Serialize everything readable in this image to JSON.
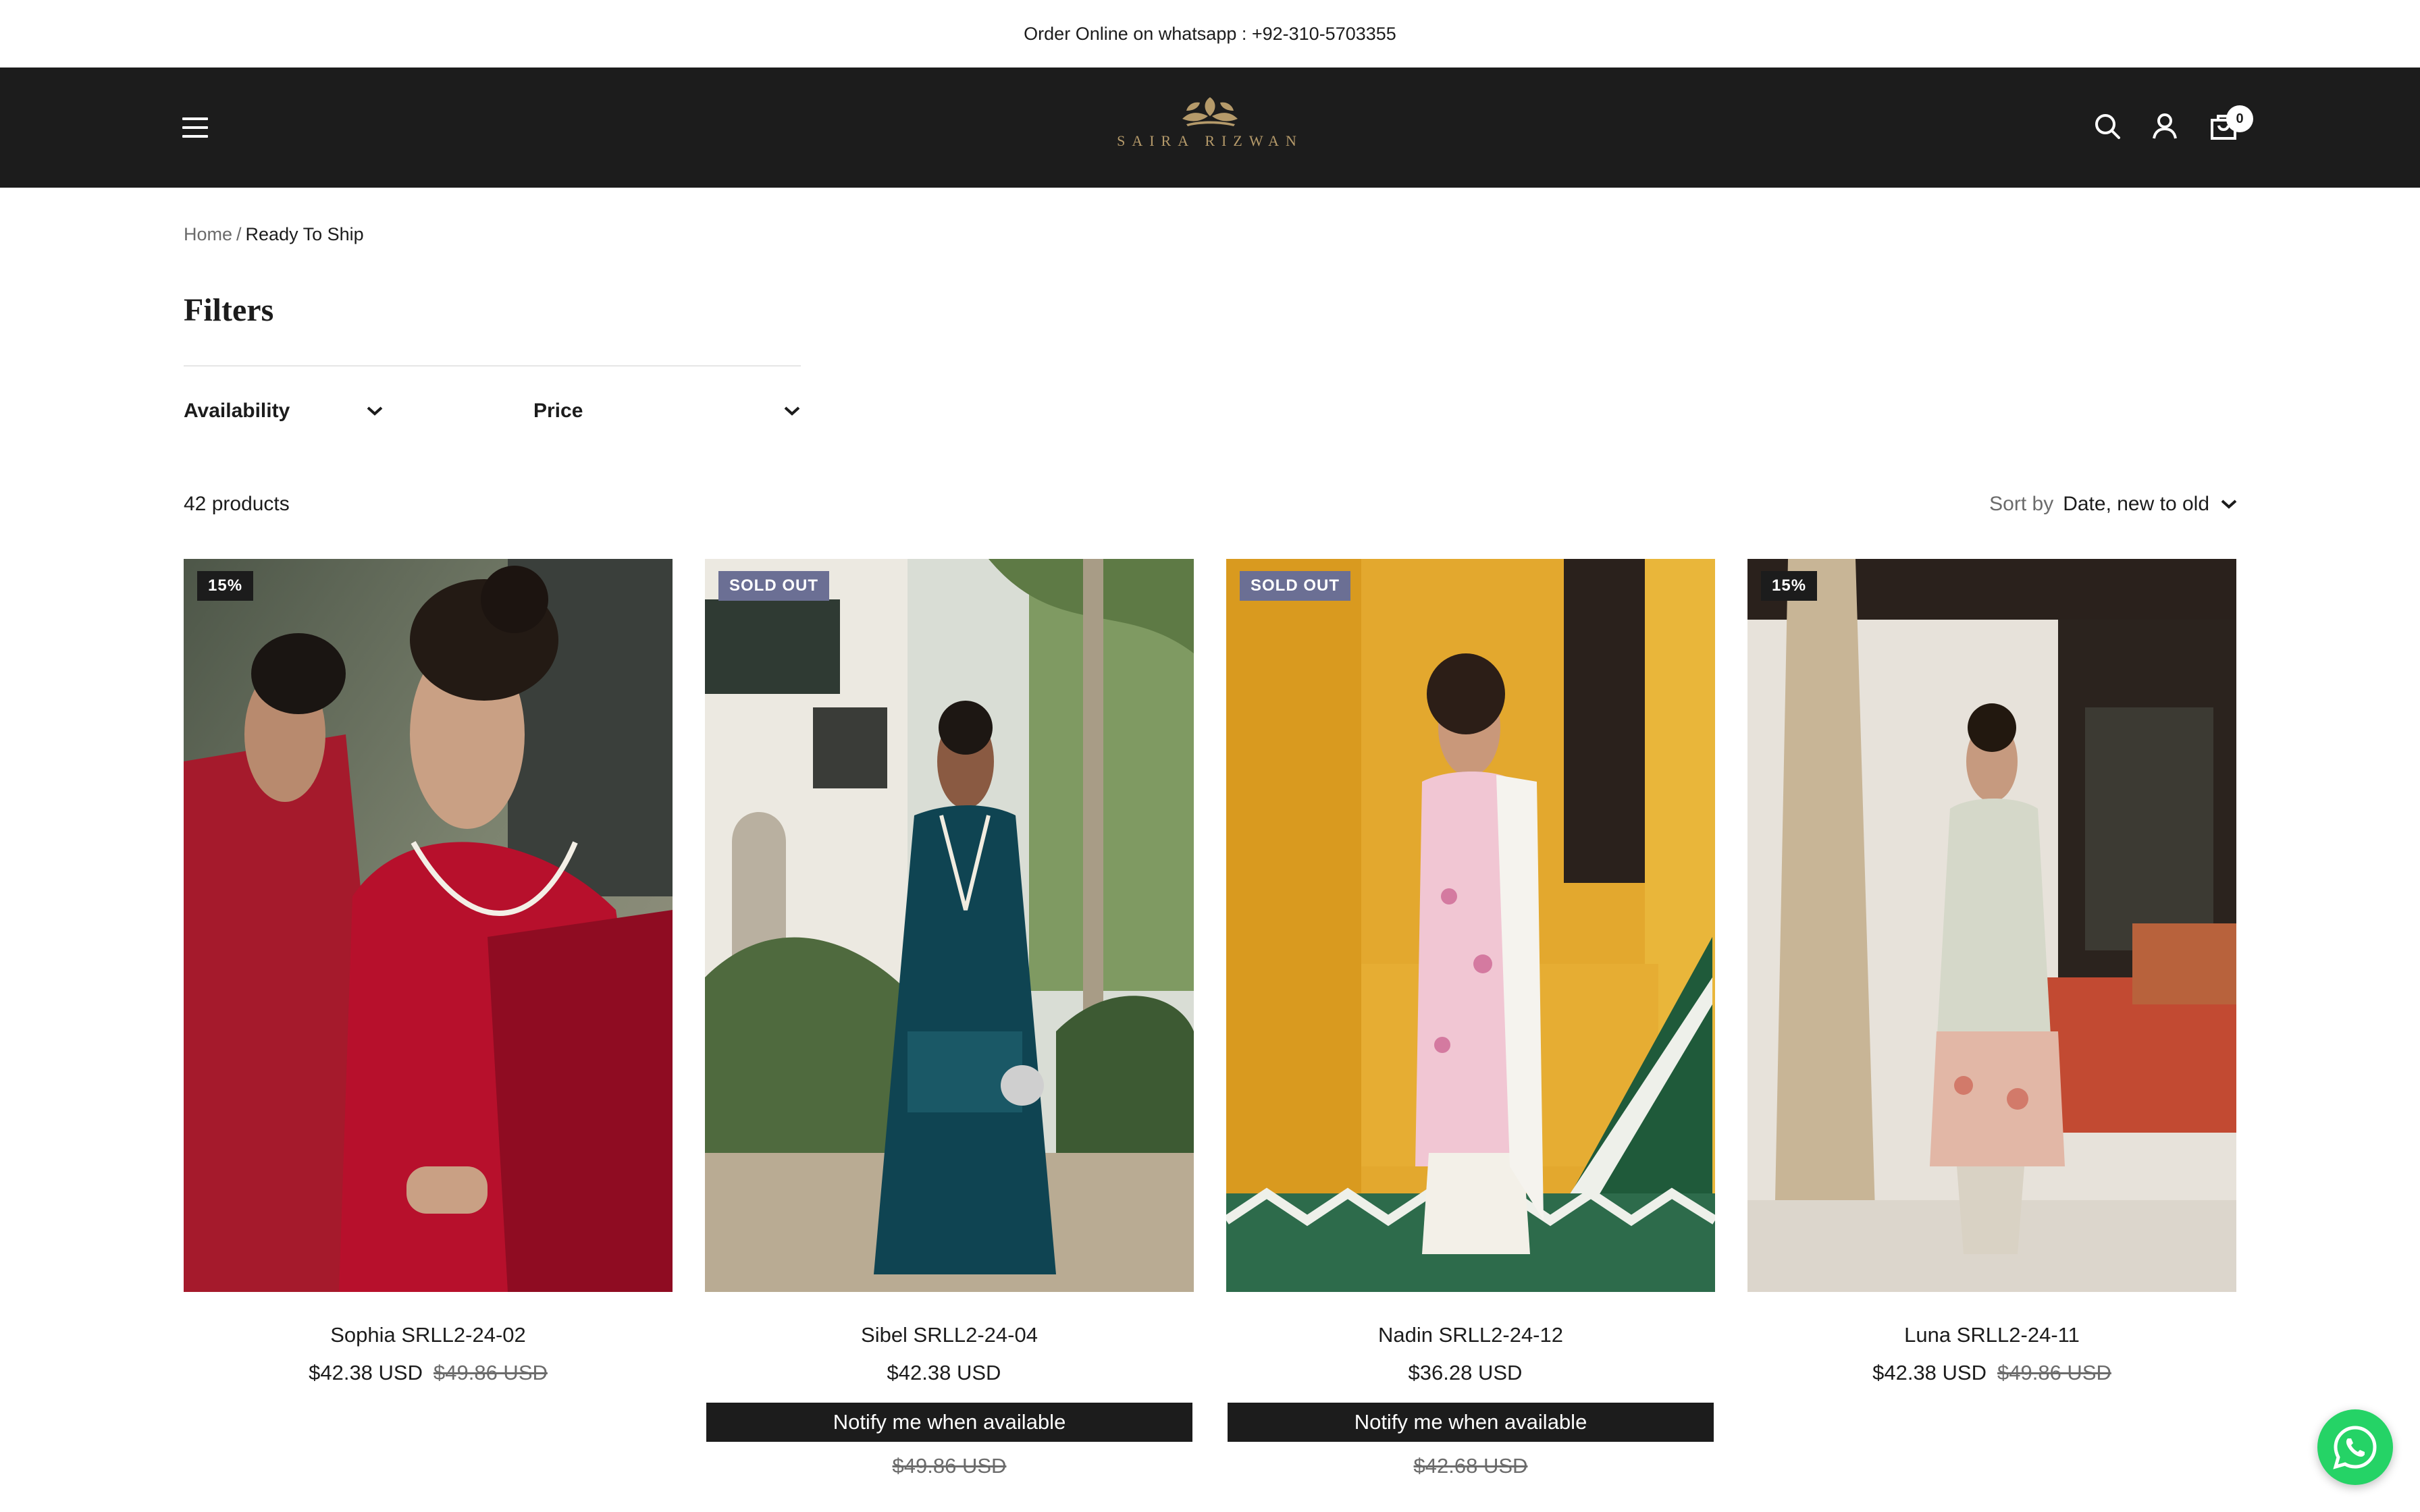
{
  "announcement": {
    "text": "Order Online on whatsapp : +92-310-5703355"
  },
  "header": {
    "logo_text": "SAIRA RIZWAN",
    "icons": [
      "menu-icon",
      "search-icon",
      "account-icon",
      "cart-icon"
    ],
    "cart_count": "0"
  },
  "breadcrumb": {
    "home": "Home",
    "separator": "/",
    "current": "Ready To Ship"
  },
  "filters": {
    "title": "Filters",
    "availability": "Availability",
    "price": "Price"
  },
  "toolbar": {
    "product_count": "42 products",
    "sort_label": "Sort by",
    "sort_value": "Date, new to old"
  },
  "products": [
    {
      "name": "Sophia SRLL2-24-02",
      "badge": "15%",
      "price": "$42.38 USD",
      "compare_price": "$49.86 USD"
    },
    {
      "name": "Sibel SRLL2-24-04",
      "badge": "SOLD OUT",
      "price": "$42.38 USD",
      "notify": "Notify me when available",
      "compare_price": "$49.86 USD"
    },
    {
      "name": "Nadin SRLL2-24-12",
      "badge": "SOLD OUT",
      "price": "$36.28 USD",
      "notify": "Notify me when available",
      "compare_price": "$42.68 USD"
    },
    {
      "name": "Luna SRLL2-24-11",
      "badge": "15%",
      "price": "$42.38 USD",
      "compare_price": "$49.86 USD"
    }
  ],
  "colors": {
    "header_bg": "#1c1c1c",
    "logo_gold": "#b59a6a",
    "sold_out_badge": "#6b6f94",
    "whatsapp_green": "#25d366"
  }
}
